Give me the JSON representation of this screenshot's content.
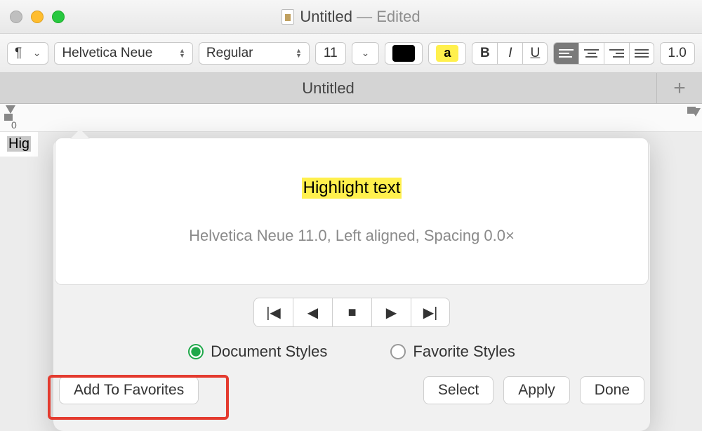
{
  "window": {
    "title": "Untitled",
    "edited_suffix": " — Edited"
  },
  "toolbar": {
    "paragraph_symbol": "¶",
    "font_family": "Helvetica Neue",
    "font_style": "Regular",
    "font_size": "11",
    "highlight_sample": "a",
    "bold": "B",
    "italic": "I",
    "underline": "U",
    "line_spacing": "1.0"
  },
  "tab": {
    "name": "Untitled",
    "new_tab": "+"
  },
  "ruler": {
    "zero": "0"
  },
  "document": {
    "visible_text": "Hig"
  },
  "popover": {
    "preview_text": "Highlight text",
    "style_description": "Helvetica Neue 11.0, Left aligned, Spacing 0.0×",
    "radio_document": "Document Styles",
    "radio_favorite": "Favorite Styles",
    "add_favorites": "Add To Favorites",
    "select": "Select",
    "apply": "Apply",
    "done": "Done"
  }
}
